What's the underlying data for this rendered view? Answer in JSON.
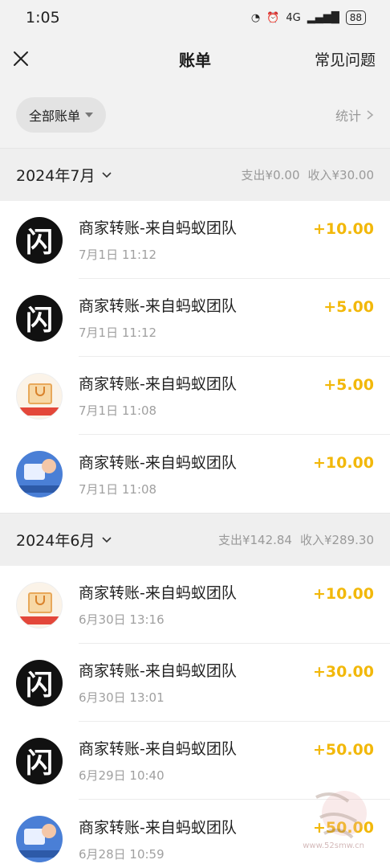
{
  "status": {
    "time": "1:05",
    "network": "4G",
    "battery": "88"
  },
  "nav": {
    "title": "账单",
    "faq": "常见问题"
  },
  "filter": {
    "label": "全部账单",
    "stats_label": "统计"
  },
  "months": [
    {
      "label": "2024年7月",
      "expense": "支出¥0.00",
      "income": "收入¥30.00",
      "items": [
        {
          "avatar": "shan",
          "title": "商家转账-来自蚂蚁团队",
          "time": "7月1日 11:12",
          "amount": "+10.00"
        },
        {
          "avatar": "shan",
          "title": "商家转账-来自蚂蚁团队",
          "time": "7月1日 11:12",
          "amount": "+5.00"
        },
        {
          "avatar": "bag",
          "title": "商家转账-来自蚂蚁团队",
          "time": "7月1日 11:08",
          "amount": "+5.00"
        },
        {
          "avatar": "robot",
          "title": "商家转账-来自蚂蚁团队",
          "time": "7月1日 11:08",
          "amount": "+10.00"
        }
      ]
    },
    {
      "label": "2024年6月",
      "expense": "支出¥142.84",
      "income": "收入¥289.30",
      "items": [
        {
          "avatar": "bag",
          "title": "商家转账-来自蚂蚁团队",
          "time": "6月30日 13:16",
          "amount": "+10.00"
        },
        {
          "avatar": "shan",
          "title": "商家转账-来自蚂蚁团队",
          "time": "6月30日 13:01",
          "amount": "+30.00"
        },
        {
          "avatar": "shan",
          "title": "商家转账-来自蚂蚁团队",
          "time": "6月29日 10:40",
          "amount": "+50.00"
        },
        {
          "avatar": "robot",
          "title": "商家转账-来自蚂蚁团队",
          "time": "6月28日 10:59",
          "amount": "+50.00"
        }
      ]
    }
  ],
  "avatar_glyph": "闪",
  "watermark": {
    "text": "www.52smw.cn"
  },
  "colors": {
    "amount": "#f2b80a",
    "background": "#f2f2f2"
  }
}
